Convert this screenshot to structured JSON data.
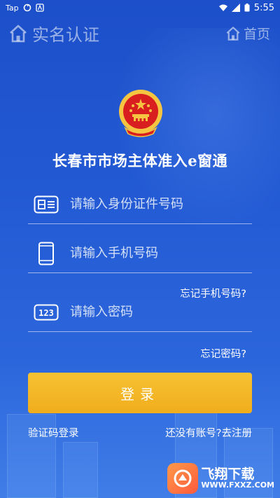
{
  "status_bar": {
    "left_label": "Tap",
    "time": "5:55"
  },
  "nav": {
    "title": "实名认证",
    "home_label": "首页",
    "back_icon": "home-outline-icon",
    "home_icon": "home-outline-icon"
  },
  "app": {
    "title": "长春市市场主体准入e窗通"
  },
  "form": {
    "id_placeholder": "请输入身份证件号码",
    "phone_placeholder": "请输入手机号码",
    "forgot_phone": "忘记手机号码?",
    "password_placeholder": "请输入密码",
    "forgot_password": "忘记密码?",
    "login_button": "登录"
  },
  "links": {
    "sms_login": "验证码登录",
    "register": "还没有账号?去注册"
  },
  "watermark": {
    "brand": "飞翔下载",
    "url": "WWW.FXXZ.COM"
  },
  "colors": {
    "background_top": "#1c4fc9",
    "background_bottom": "#2f6fe2",
    "button": "#f2b124",
    "emblem_red": "#d81e1e",
    "emblem_gold": "#f5c542"
  }
}
